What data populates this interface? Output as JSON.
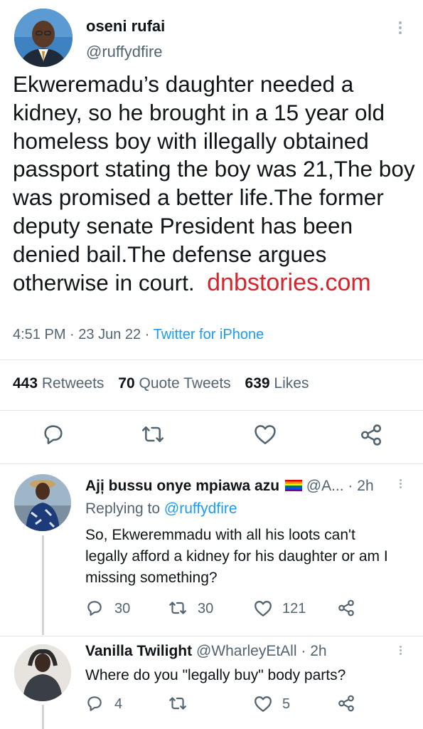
{
  "main_tweet": {
    "author_name": "oseni rufai",
    "author_handle": "@ruffydfire",
    "text": "Ekweremadu’s daughter needed a kidney, so he brought in a 15 year old homeless boy with illegally obtained passport stating the boy was 21,The boy was  promised a better life.The former deputy senate President has been denied bail.The defense argues otherwise in court.",
    "watermark": "dnbstories.com",
    "time": "4:51 PM",
    "date": "23 Jun 22",
    "source": "Twitter for iPhone",
    "separator": "·",
    "retweets_count": "443",
    "retweets_label": "Retweets",
    "quotes_count": "70",
    "quotes_label": "Quote Tweets",
    "likes_count": "639",
    "likes_label": "Likes"
  },
  "replies": [
    {
      "author_name": "Aji̦ bussu onye mpiawa azu",
      "author_handle": "@A...",
      "time": "2h",
      "replying_to_label": "Replying to",
      "replying_to_handle": "@ruffydfire",
      "text": "So, Ekweremmadu with all his loots can't legally afford a kidney for his daughter or am I missing something?",
      "reply_count": "30",
      "retweet_count": "30",
      "like_count": "121"
    },
    {
      "author_name": "Vanilla Twilight",
      "author_handle": "@WharleyEtAll",
      "time": "2h",
      "text": "Where do you \"legally buy\" body parts?",
      "reply_count": "4",
      "retweet_count": "",
      "like_count": "5"
    }
  ],
  "colors": {
    "accent": "#1d9bf0",
    "watermark": "#d8232a",
    "muted": "#536471",
    "text": "#0f1419"
  },
  "icons": [
    "reply-icon",
    "retweet-icon",
    "like-icon",
    "share-icon",
    "more-icon",
    "rainbow-flag-icon"
  ]
}
